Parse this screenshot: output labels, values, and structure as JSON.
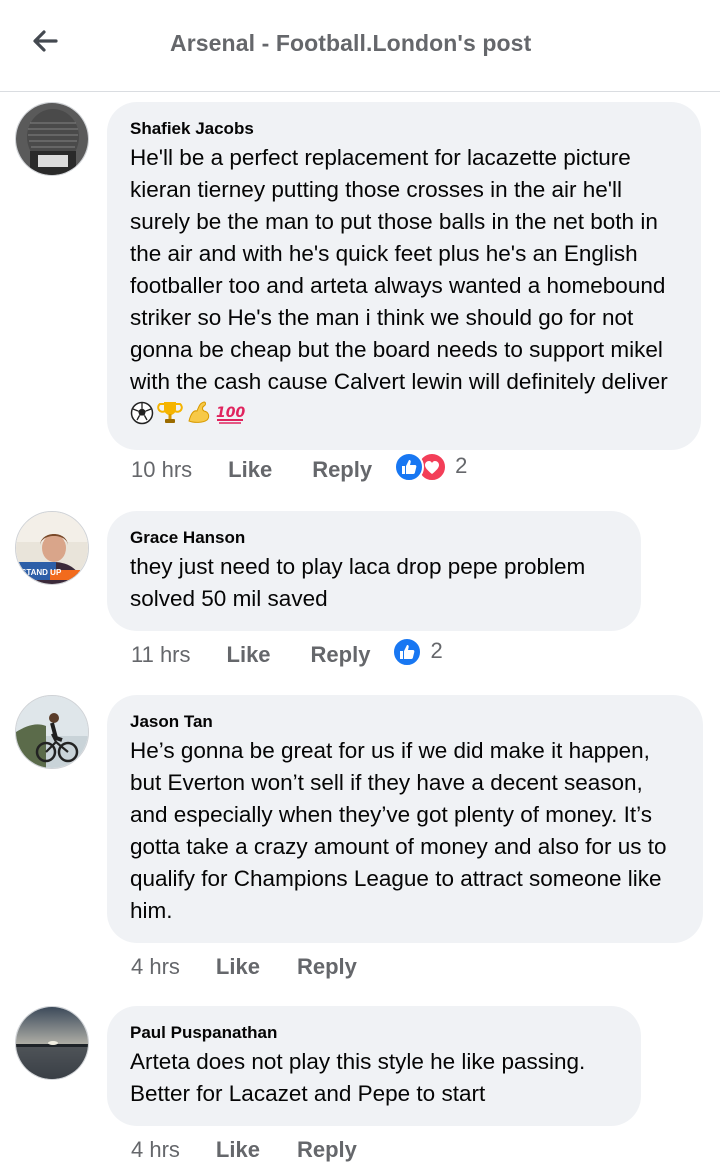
{
  "header": {
    "title": "Arsenal - Football.London's post"
  },
  "comments": [
    {
      "author": "Shafiek Jacobs",
      "text": "He'll be a perfect replacement for lacazette picture kieran tierney putting those crosses in the air he'll surely be the man to put those balls in the net both in the air and with he's quick feet plus he's an English footballer too and arteta always wanted a homebound striker so He's the man i think we should go for not gonna be cheap but the board needs to support mikel with the cash cause Calvert lewin will definitely deliver",
      "emojis": [
        "soccer-ball",
        "trophy",
        "flexed-biceps",
        "hundred-points"
      ],
      "time": "10 hrs",
      "like_label": "Like",
      "reply_label": "Reply",
      "reactions": [
        "like",
        "love"
      ],
      "reaction_count": "2"
    },
    {
      "author": "Grace Hanson",
      "avatar_caption": "STAND UP",
      "text": "they just need to play laca drop pepe problem solved 50 mil saved",
      "time": "11 hrs",
      "like_label": "Like",
      "reply_label": "Reply",
      "reactions": [
        "like"
      ],
      "reaction_count": "2"
    },
    {
      "author": "Jason Tan",
      "text": "He’s gonna be great for us if we did make it happen, but Everton won’t sell if they have a decent season, and especially when they’ve got plenty of money. It’s gotta take a crazy amount of money and also for us to qualify for Champions League to attract someone like him.",
      "time": "4 hrs",
      "like_label": "Like",
      "reply_label": "Reply"
    },
    {
      "author": "Paul Puspanathan",
      "text": "Arteta does not play this style he like passing. Better for Lacazet and Pepe to start",
      "time": "4 hrs",
      "like_label": "Like",
      "reply_label": "Reply"
    }
  ],
  "colors": {
    "bubble": "#f0f2f5",
    "secondary_text": "#65676b",
    "like_blue": "#1877f2",
    "love_red": "#f33e58"
  }
}
